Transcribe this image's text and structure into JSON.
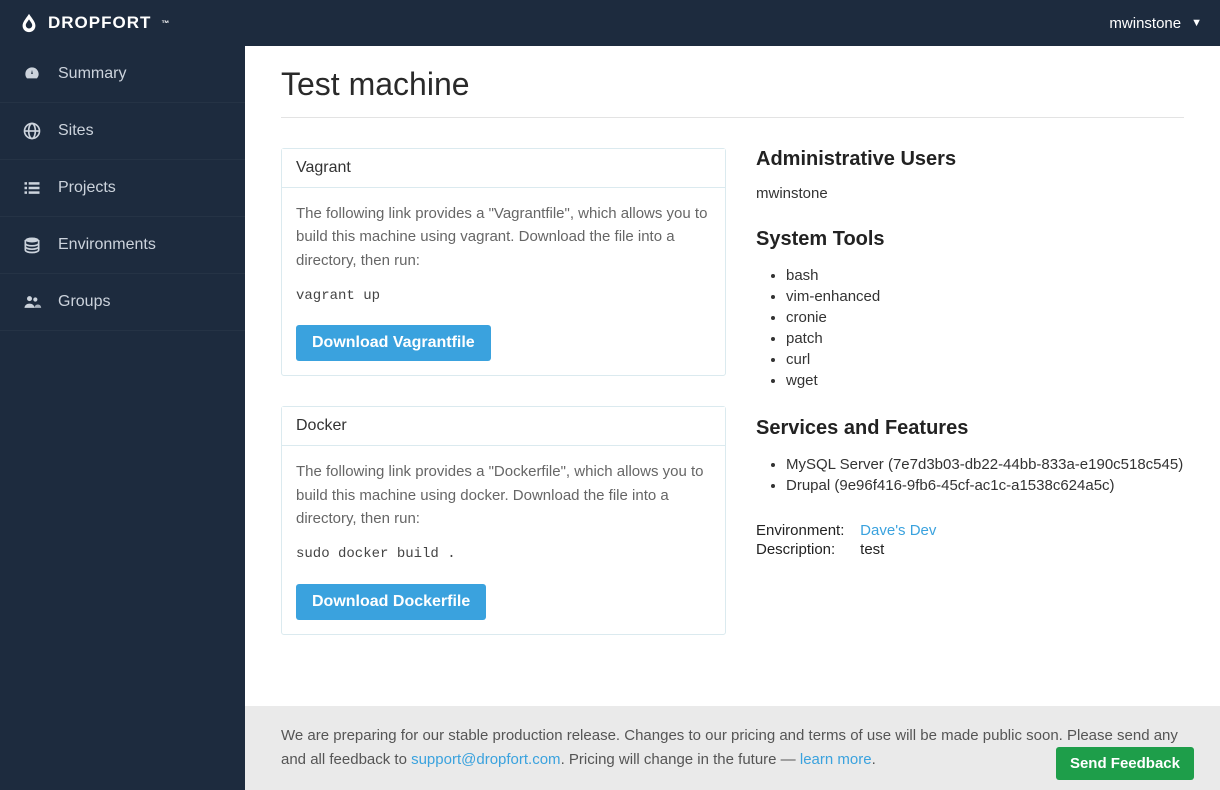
{
  "brand": {
    "name": "DROPFORT",
    "tm": "™"
  },
  "user": {
    "name": "mwinstone"
  },
  "sidebar": {
    "items": [
      {
        "label": "Summary",
        "icon": "dashboard"
      },
      {
        "label": "Sites",
        "icon": "globe"
      },
      {
        "label": "Projects",
        "icon": "list"
      },
      {
        "label": "Environments",
        "icon": "stack"
      },
      {
        "label": "Groups",
        "icon": "users"
      }
    ]
  },
  "page": {
    "title": "Test machine"
  },
  "vagrant": {
    "heading": "Vagrant",
    "desc": "The following link provides a \"Vagrantfile\", which allows you to build this machine using vagrant. Download the file into a directory, then run:",
    "cmd": "vagrant up",
    "button": "Download Vagrantfile"
  },
  "docker": {
    "heading": "Docker",
    "desc": "The following link provides a \"Dockerfile\", which allows you to build this machine using docker. Download the file into a directory, then run:",
    "cmd": "sudo docker build .",
    "button": "Download Dockerfile"
  },
  "admin": {
    "heading": "Administrative Users",
    "users": [
      "mwinstone"
    ]
  },
  "tools": {
    "heading": "System Tools",
    "items": [
      "bash",
      "vim-enhanced",
      "cronie",
      "patch",
      "curl",
      "wget"
    ]
  },
  "services": {
    "heading": "Services and Features",
    "items": [
      "MySQL Server (7e7d3b03-db22-44bb-833a-e190c518c545)",
      "Drupal (9e96f416-9fb6-45cf-ac1c-a1538c624a5c)"
    ]
  },
  "meta": {
    "env_label": "Environment:",
    "env_value": "Dave's Dev",
    "desc_label": "Description:",
    "desc_value": "test"
  },
  "footer": {
    "text1": "We are preparing for our stable production release. Changes to our pricing and terms of use will be made public soon. Please send any and all feedback to ",
    "email": "support@dropfort.com",
    "text2": ". Pricing will change in the future — ",
    "learn": "learn more",
    "text3": ".",
    "feedback_btn": "Send Feedback"
  }
}
